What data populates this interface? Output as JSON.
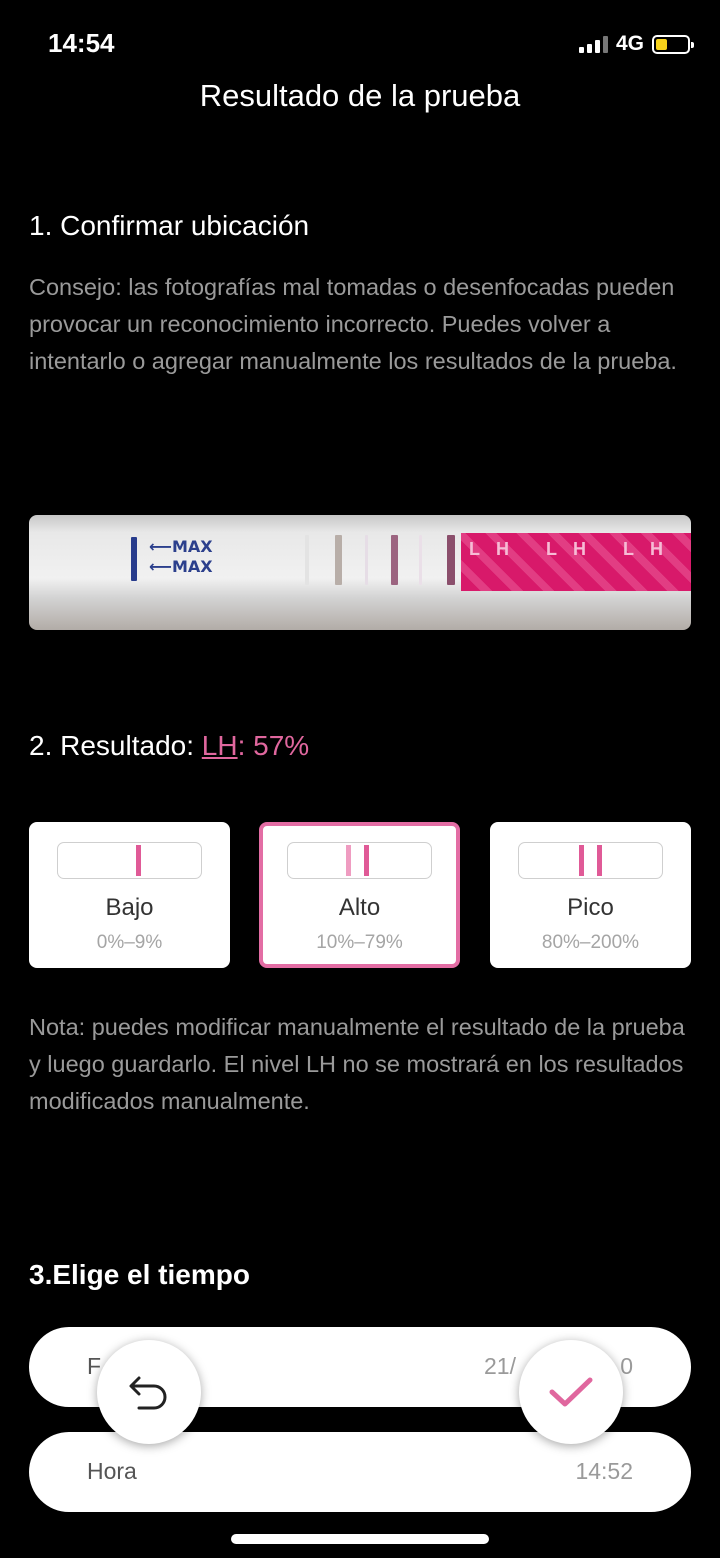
{
  "status": {
    "time": "14:54",
    "network": "4G",
    "battery_color": "#f7d21a"
  },
  "header": {
    "title": "Resultado de la prueba"
  },
  "section1": {
    "title": "1. Confirmar ubicación",
    "tip": "Consejo: las fotografías mal tomadas o desenfocadas pueden provocar un reconocimiento incorrecto. Puedes volver a intentarlo o agregar manualmente los resultados de la prueba."
  },
  "strip": {
    "max_label_1": "⟵MAX",
    "max_label_2": "⟵MAX",
    "brand_text": "LH LH LH"
  },
  "section2": {
    "title_prefix": "2. Resultado: ",
    "lh_label": "LH",
    "value_text": ": 57%",
    "levels": [
      {
        "name": "Bajo",
        "range": "0%–9%",
        "lines": 1,
        "selected": false
      },
      {
        "name": "Alto",
        "range": "10%–79%",
        "lines": 2,
        "selected": true
      },
      {
        "name": "Pico",
        "range": "80%–200%",
        "lines": 2,
        "selected": false
      }
    ],
    "note": "Nota: puedes modificar manualmente el resultado de la prueba y luego guardarlo. El nivel LH no se mostrará en los resultados modificados manualmente."
  },
  "section3": {
    "title": "3.Elige el tiempo",
    "date_label": "F",
    "date_value": "21/",
    "date_value_tail": "0",
    "time_label": "Hora",
    "time_value": "14:52"
  },
  "actions": {
    "back_icon": "undo-arrow-icon",
    "confirm_icon": "check-icon"
  },
  "colors": {
    "accent": "#e0679e",
    "background": "#000000"
  }
}
